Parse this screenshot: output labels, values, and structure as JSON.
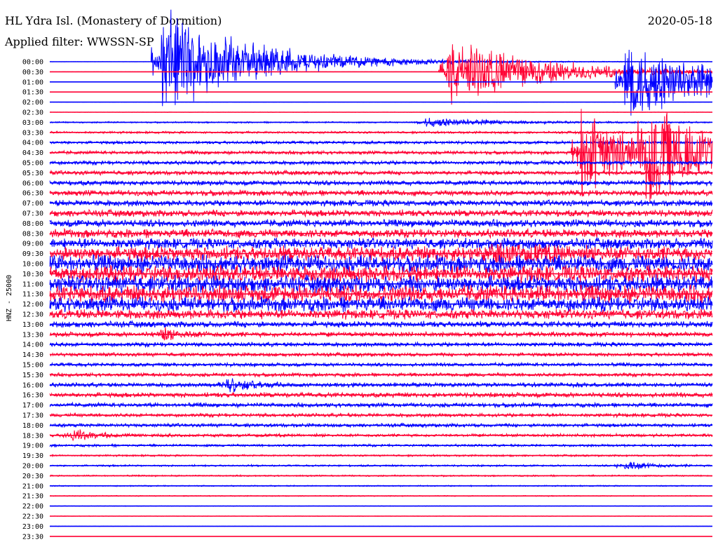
{
  "header": {
    "station": "HL Ydra Isl. (Monastery of Dormition)",
    "date": "2020-05-18",
    "filter": "Applied filter: WWSSN-SP"
  },
  "chart_data": {
    "type": "line",
    "title": "HL Ydra Isl. (Monastery of Dormition)",
    "ylabel": "HNZ - 25000",
    "colors": {
      "trace_a": "#0000ff",
      "trace_b": "#ff0033"
    },
    "row_labels": [
      "00:00",
      "00:30",
      "01:00",
      "01:30",
      "02:00",
      "02:30",
      "03:00",
      "03:30",
      "04:00",
      "04:30",
      "05:00",
      "05:30",
      "06:00",
      "06:30",
      "07:00",
      "07:30",
      "08:00",
      "08:30",
      "09:00",
      "09:30",
      "10:00",
      "10:30",
      "11:00",
      "11:30",
      "12:00",
      "12:30",
      "13:00",
      "13:30",
      "14:00",
      "14:30",
      "15:00",
      "15:30",
      "16:00",
      "16:30",
      "17:00",
      "17:30",
      "18:00",
      "18:30",
      "19:00",
      "19:30",
      "20:00",
      "20:30",
      "21:00",
      "21:30",
      "22:00",
      "22:30",
      "23:00",
      "23:30"
    ],
    "row_amplitude": [
      0.2,
      0.2,
      0.2,
      0.2,
      0.2,
      0.3,
      1.2,
      1.8,
      2.5,
      2.8,
      3.2,
      3.5,
      4,
      4.5,
      5,
      5.5,
      6,
      7,
      9,
      12,
      14,
      14,
      14,
      14,
      12,
      8,
      5,
      4,
      3.5,
      3,
      3,
      3,
      3.5,
      4,
      3.5,
      3,
      3,
      2.5,
      2,
      1.5,
      1.5,
      1.2,
      1,
      0.8,
      0.5,
      0.4,
      0.3,
      0.3
    ],
    "events": [
      {
        "time": "00:00",
        "minute": 5,
        "peak": 90,
        "decay_min": 4
      },
      {
        "time": "00:30",
        "minute": 18,
        "peak": 60,
        "decay_min": 4
      },
      {
        "time": "01:00",
        "minute": 26,
        "peak": 70,
        "decay_min": 4
      },
      {
        "time": "03:00",
        "minute": 17,
        "peak": 8,
        "decay_min": 3
      },
      {
        "time": "04:30",
        "minute": 24,
        "peak": 70,
        "decay_min": 3
      },
      {
        "time": "04:30",
        "minute": 27,
        "peak": 70,
        "decay_min": 3
      },
      {
        "time": "09:30",
        "minute": 20,
        "peak": 12,
        "decay_min": 2
      },
      {
        "time": "13:30",
        "minute": 5,
        "peak": 10,
        "decay_min": 1
      },
      {
        "time": "16:00",
        "minute": 8,
        "peak": 12,
        "decay_min": 1
      },
      {
        "time": "18:30",
        "minute": 1,
        "peak": 10,
        "decay_min": 1
      },
      {
        "time": "20:00",
        "minute": 26,
        "peak": 10,
        "decay_min": 1
      }
    ]
  }
}
